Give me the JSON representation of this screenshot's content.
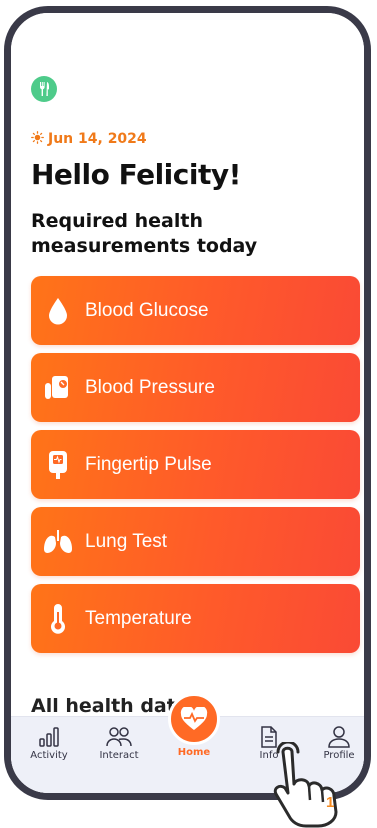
{
  "header": {
    "logo_icon": "fork-knife-icon",
    "date_icon": "sun-icon",
    "date": "Jun 14, 2024",
    "greeting": "Hello Felicity!",
    "subtitle": "Required health measurements today"
  },
  "measurements": [
    {
      "label": "Blood Glucose",
      "icon": "blood-drop-icon"
    },
    {
      "label": "Blood Pressure",
      "icon": "blood-pressure-monitor-icon"
    },
    {
      "label": "Fingertip Pulse",
      "icon": "pulse-oximeter-icon"
    },
    {
      "label": "Lung Test",
      "icon": "lungs-icon"
    },
    {
      "label": "Temperature",
      "icon": "thermometer-icon"
    }
  ],
  "section": {
    "title": "All health data"
  },
  "tabs": {
    "activity": "Activity",
    "interact": "Interact",
    "home": "Home",
    "info": "Info",
    "profile": "Profile"
  },
  "tap_hint": {
    "number": "1"
  },
  "colors": {
    "accent": "#ff6a25",
    "card_start": "#ff7418",
    "card_end": "#fa4a35",
    "logo": "#4ecb8a",
    "tabbar": "#eef0f8"
  }
}
